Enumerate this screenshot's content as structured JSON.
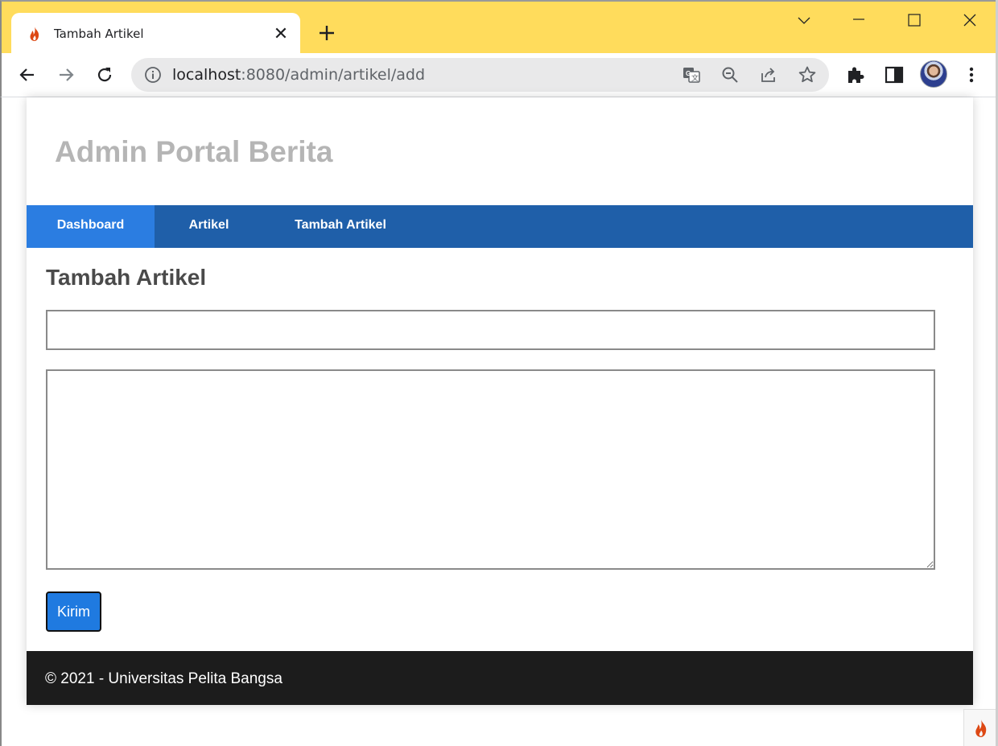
{
  "browser": {
    "tab": {
      "title": "Tambah Artikel",
      "favicon": "flame-icon"
    },
    "url": {
      "host": "localhost",
      "rest": ":8080/admin/artikel/add"
    },
    "icons": [
      "back-arrow-icon",
      "forward-arrow-icon",
      "reload-icon",
      "info-icon",
      "translate-icon",
      "zoom-out-icon",
      "share-icon",
      "star-icon",
      "extensions-icon",
      "side-panel-icon",
      "profile-avatar",
      "more-menu-icon"
    ],
    "theme_color": "#ffdc5c"
  },
  "site": {
    "title": "Admin Portal Berita",
    "nav": [
      {
        "label": "Dashboard",
        "active": true
      },
      {
        "label": "Artikel",
        "active": false
      },
      {
        "label": "Tambah Artikel",
        "active": false
      }
    ],
    "nav_color": "#1f5fa9",
    "nav_active_color": "#2b7de1"
  },
  "form": {
    "heading": "Tambah Artikel",
    "title_value": "",
    "content_value": "",
    "submit_label": "Kirim",
    "button_color": "#1f7ae0"
  },
  "footer": {
    "text": "© 2021 - Universitas Pelita Bangsa"
  }
}
